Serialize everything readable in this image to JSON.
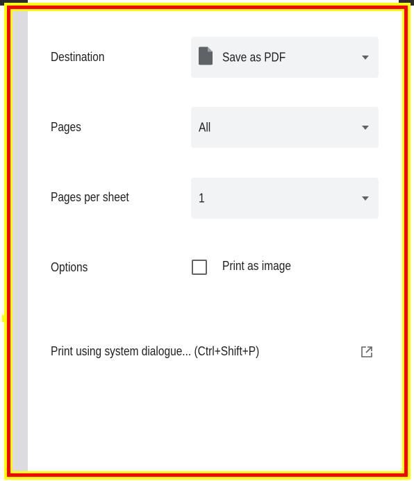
{
  "destination": {
    "label": "Destination",
    "value": "Save as PDF",
    "icon": "file-icon"
  },
  "pages": {
    "label": "Pages",
    "value": "All"
  },
  "pages_per_sheet": {
    "label": "Pages per sheet",
    "value": "1"
  },
  "options": {
    "label": "Options",
    "print_as_image_label": "Print as image",
    "print_as_image_checked": false
  },
  "system_dialog": {
    "label": "Print using system dialogue... (Ctrl+Shift+P)",
    "icon": "open-in-new-icon"
  },
  "colors": {
    "outer_highlight": "#ffff00",
    "inner_highlight": "#ff0000",
    "select_bg": "#f1f3f4",
    "text": "#202124",
    "icon": "#5f6368"
  }
}
